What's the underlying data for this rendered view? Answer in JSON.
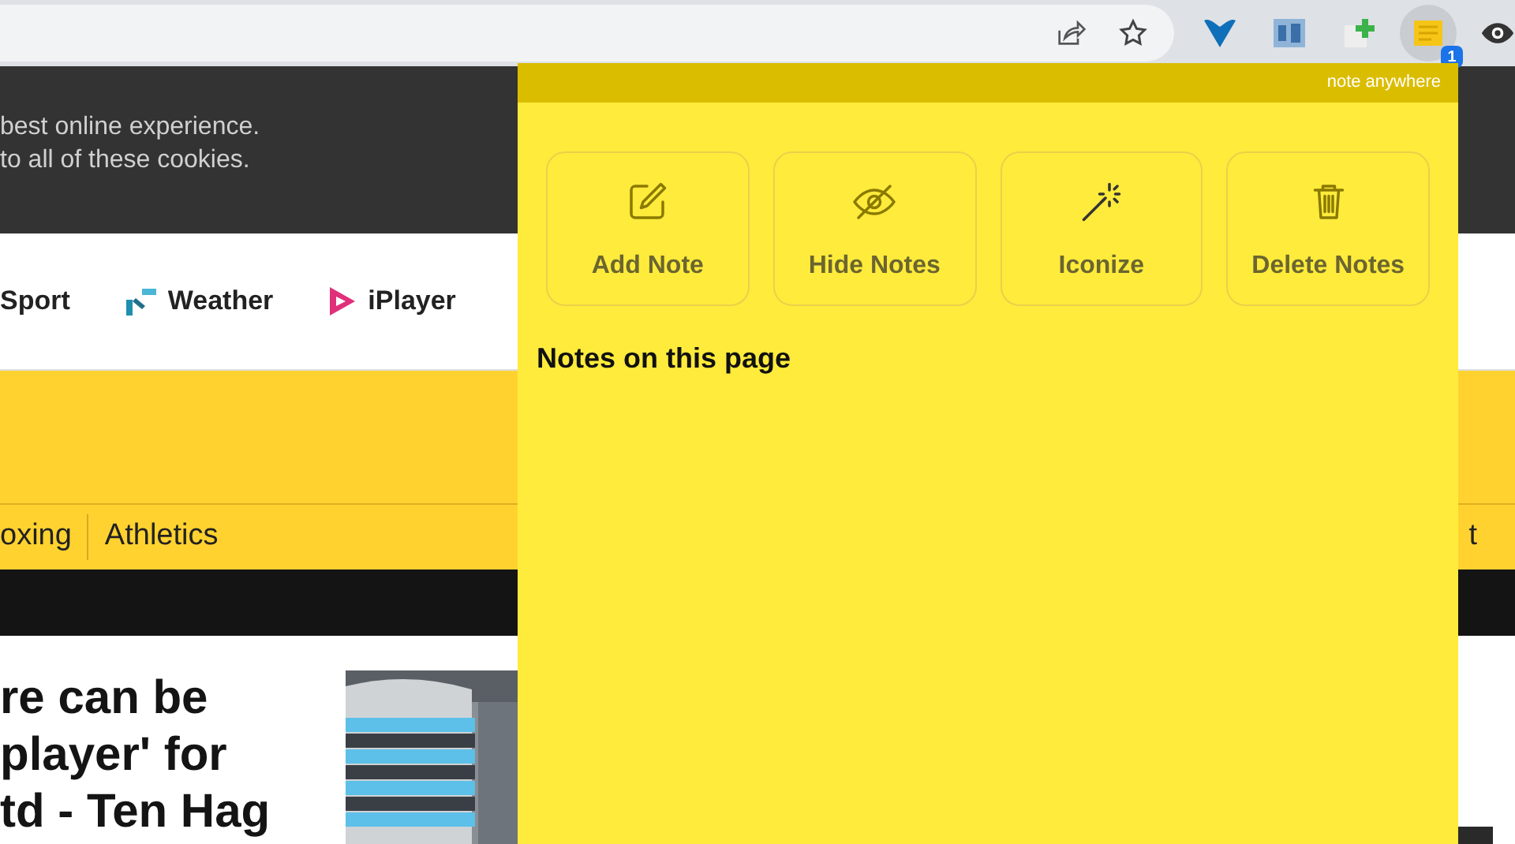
{
  "cookie_banner": {
    "lines": [
      "best online experience.",
      "to all of these cookies."
    ]
  },
  "nav": {
    "items": [
      {
        "label": "Sport",
        "kind": "plain"
      },
      {
        "label": "Weather",
        "kind": "weather"
      },
      {
        "label": "iPlayer",
        "kind": "iplayer"
      }
    ]
  },
  "sport_nav": {
    "items": [
      "oxing",
      "Athletics"
    ],
    "cut_item": "t"
  },
  "headline": {
    "lines": [
      "re can be",
      "player' for",
      "td - Ten Hag"
    ]
  },
  "extension_badge": "1",
  "popup": {
    "brand": "note anywhere",
    "actions": [
      {
        "label": "Add Note",
        "kind": "add"
      },
      {
        "label": "Hide Notes",
        "kind": "hide"
      },
      {
        "label": "Iconize",
        "kind": "iconize"
      },
      {
        "label": "Delete Notes",
        "kind": "delete"
      }
    ],
    "section_title": "Notes on this page"
  }
}
